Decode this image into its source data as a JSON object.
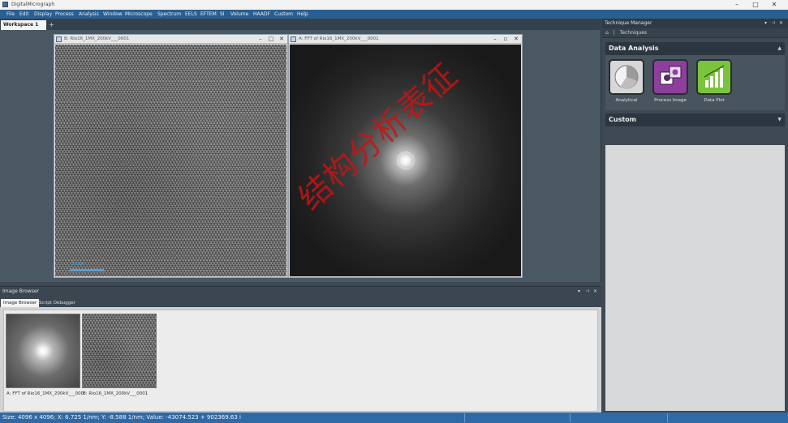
{
  "app": {
    "title": "DigitalMicrograph"
  },
  "menu": [
    "File",
    "Edit",
    "Display",
    "Process",
    "Analysis",
    "Window",
    "Microscope",
    "Spectrum",
    "EELS",
    "EFTEM",
    "SI",
    "Volume",
    "HAADF",
    "Custom",
    "Help"
  ],
  "workspace_tab": "Workspace 1",
  "windows": {
    "left": {
      "title": "B: Rio16_1MX_200kV___0001"
    },
    "right": {
      "title": "A: FFT of Rio16_1MX_200kV___0001"
    }
  },
  "scalebar_label": "5 nm",
  "watermark": "结构分析表征",
  "technique_manager": {
    "title": "Technique Manager",
    "crumb": "Techniques",
    "sections": {
      "data_analysis": "Data Analysis",
      "custom": "Custom"
    },
    "tiles": [
      {
        "label": "Analytical",
        "icon": "pie-chart-icon",
        "color": "#d7d7d7"
      },
      {
        "label": "Process Image",
        "icon": "process-image-icon",
        "color": "#8e3f9e"
      },
      {
        "label": "Data Plot",
        "icon": "bar-chart-icon",
        "color": "#7cc33c"
      }
    ]
  },
  "image_browser": {
    "title": "Image Browser",
    "tabs": [
      "Image Browser",
      "Script Debugger"
    ],
    "thumbs": [
      "A: FFT of Rio16_1MX_200kV___0001",
      "B: Rio16_1MX_200kV___0001"
    ]
  },
  "status": "Size: 4096 x 4096;  X: 6.725 1/nm;  Y: -8.588 1/nm;  Value: -43074.523 + 902369.63 i"
}
